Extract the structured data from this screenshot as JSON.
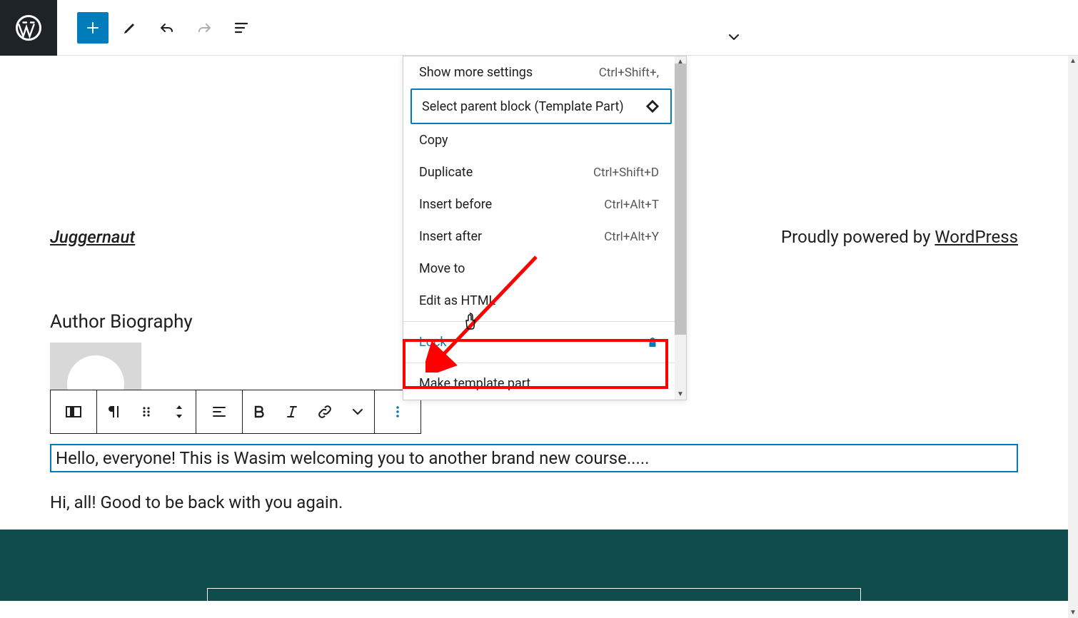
{
  "site": {
    "title": "Juggernaut",
    "powered_prefix": "Proudly powered by ",
    "powered_link": "WordPress"
  },
  "author": {
    "heading": "Author Biography"
  },
  "paragraphs": {
    "selected": "Hello, everyone! This is Wasim welcoming you to another brand new course.....",
    "second": "Hi, all! Good to be back with you again."
  },
  "menu": {
    "show_more": {
      "label": "Show more settings",
      "shortcut": "Ctrl+Shift+,"
    },
    "select_parent": {
      "label": "Select parent block (Template Part)"
    },
    "copy": {
      "label": "Copy"
    },
    "duplicate": {
      "label": "Duplicate",
      "shortcut": "Ctrl+Shift+D"
    },
    "insert_before": {
      "label": "Insert before",
      "shortcut": "Ctrl+Alt+T"
    },
    "insert_after": {
      "label": "Insert after",
      "shortcut": "Ctrl+Alt+Y"
    },
    "move_to": {
      "label": "Move to"
    },
    "edit_html": {
      "label": "Edit as HTML"
    },
    "lock": {
      "label": "Lock"
    },
    "make_template_part": {
      "label": "Make template part"
    }
  }
}
